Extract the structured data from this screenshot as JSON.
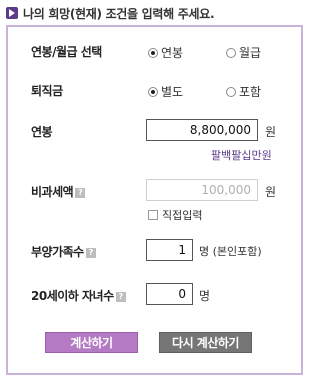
{
  "header": {
    "title": "나의 희망(현재) 조건을 입력해 주세요."
  },
  "salary_type": {
    "label": "연봉/월급 선택",
    "options": [
      {
        "label": "연봉",
        "checked": true
      },
      {
        "label": "월급",
        "checked": false
      }
    ]
  },
  "severance": {
    "label": "퇴직금",
    "options": [
      {
        "label": "별도",
        "checked": true
      },
      {
        "label": "포함",
        "checked": false
      }
    ]
  },
  "salary": {
    "label": "연봉",
    "value": "8,800,000",
    "unit": "원",
    "korean_amount": "팔백팔십만원"
  },
  "nontax": {
    "label": "비과세액",
    "help_icon": "?",
    "value": "100,000",
    "unit": "원",
    "direct_input_label": "직접입력"
  },
  "dependents": {
    "label": "부양가족수",
    "help_icon": "?",
    "value": "1",
    "unit": "명 (본인포함)"
  },
  "children": {
    "label": "20세이하 자녀수",
    "help_icon": "?",
    "value": "0",
    "unit": "명"
  },
  "buttons": {
    "calculate": "계산하기",
    "recalculate": "다시 계산하기"
  },
  "colors": {
    "accent": "#5b3b8a",
    "panel_border": "#c9b3db",
    "calc_button": "#b47bc4",
    "reset_button": "#767676"
  }
}
